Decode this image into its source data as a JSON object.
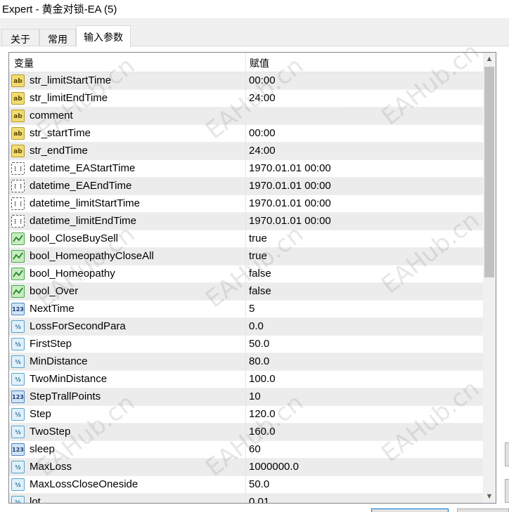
{
  "window": {
    "title": "Expert - 黄金对锁-EA (5)"
  },
  "tabs": [
    {
      "label": "关于"
    },
    {
      "label": "常用"
    },
    {
      "label": "输入参数"
    }
  ],
  "grid": {
    "header_variable": "变量",
    "header_value": "赋值"
  },
  "params": [
    {
      "icon": "ab",
      "type": "string",
      "name": "str_limitStartTime",
      "value": "00:00"
    },
    {
      "icon": "ab",
      "type": "string",
      "name": "str_limitEndTime",
      "value": "24:00"
    },
    {
      "icon": "ab",
      "type": "string",
      "name": "comment",
      "value": ""
    },
    {
      "icon": "ab",
      "type": "string",
      "name": "str_startTime",
      "value": "00:00"
    },
    {
      "icon": "ab",
      "type": "string",
      "name": "str_endTime",
      "value": "24:00"
    },
    {
      "icon": "dt",
      "type": "datetime",
      "name": "datetime_EAStartTime",
      "value": "1970.01.01 00:00"
    },
    {
      "icon": "dt",
      "type": "datetime",
      "name": "datetime_EAEndTime",
      "value": "1970.01.01 00:00"
    },
    {
      "icon": "dt",
      "type": "datetime",
      "name": "datetime_limitStartTime",
      "value": "1970.01.01 00:00"
    },
    {
      "icon": "dt",
      "type": "datetime",
      "name": "datetime_limitEndTime",
      "value": "1970.01.01 00:00"
    },
    {
      "icon": "bool",
      "type": "bool",
      "name": "bool_CloseBuySell",
      "value": "true"
    },
    {
      "icon": "bool",
      "type": "bool",
      "name": "bool_HomeopathyCloseAll",
      "value": "true"
    },
    {
      "icon": "bool",
      "type": "bool",
      "name": "bool_Homeopathy",
      "value": "false"
    },
    {
      "icon": "bool",
      "type": "bool",
      "name": "bool_Over",
      "value": "false"
    },
    {
      "icon": "123",
      "type": "int",
      "name": "NextTime",
      "value": "5"
    },
    {
      "icon": "v2",
      "type": "double",
      "name": "LossForSecondPara",
      "value": "0.0"
    },
    {
      "icon": "v2",
      "type": "double",
      "name": "FirstStep",
      "value": "50.0"
    },
    {
      "icon": "v2",
      "type": "double",
      "name": "MinDistance",
      "value": "80.0"
    },
    {
      "icon": "v2",
      "type": "double",
      "name": "TwoMinDistance",
      "value": "100.0"
    },
    {
      "icon": "123",
      "type": "int",
      "name": "StepTrallPoints",
      "value": "10"
    },
    {
      "icon": "v2",
      "type": "double",
      "name": "Step",
      "value": "120.0"
    },
    {
      "icon": "v2",
      "type": "double",
      "name": "TwoStep",
      "value": "160.0"
    },
    {
      "icon": "123",
      "type": "int",
      "name": "sleep",
      "value": "60"
    },
    {
      "icon": "v2",
      "type": "double",
      "name": "MaxLoss",
      "value": "1000000.0"
    },
    {
      "icon": "v2",
      "type": "double",
      "name": "MaxLossCloseOneside",
      "value": "50.0"
    },
    {
      "icon": "v2",
      "type": "double",
      "name": "lot",
      "value": "0.01"
    }
  ],
  "watermark": "EAHub.cn",
  "colors": {
    "string_icon": "#f2dc72",
    "bool_icon": "#c6ecc0",
    "int_icon": "#cfe3f7",
    "double_icon": "#dff1fb",
    "row_alt": "#ececec"
  }
}
